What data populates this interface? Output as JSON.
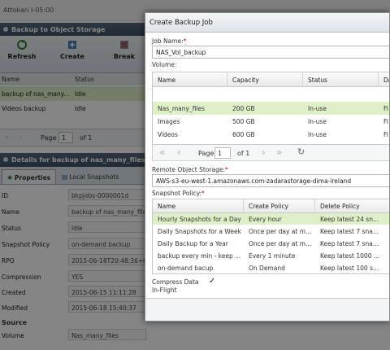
{
  "app": {
    "header_text": "Attokari I-05:00"
  },
  "bg": {
    "panel_title": "Backup to Object Storage",
    "toolbar": {
      "refresh": "Refresh",
      "create": "Create",
      "break": "Break"
    },
    "columns": [
      "Name",
      "Status"
    ],
    "rows": [
      [
        "backup of nas_many...",
        "Idle"
      ],
      [
        "Videos backup",
        "Idle"
      ]
    ],
    "pager": {
      "page_label": "Page",
      "page_value": "1",
      "of_label": "of 1"
    },
    "details_title": "Details for backup of nas_many_files",
    "tabs": [
      "Properties",
      "Local Snapshots"
    ],
    "details": [
      {
        "k": "ID",
        "v": "bkpjobs-0000001d"
      },
      {
        "k": "Name",
        "v": "backup of nas_many_files"
      },
      {
        "k": "Status",
        "v": "Idle"
      },
      {
        "k": "Snapshot Policy",
        "v": "on-demand backup"
      },
      {
        "k": "RPO",
        "v": "2015-06-18T20:48:36+00"
      },
      {
        "k": "Compression",
        "v": "YES"
      },
      {
        "k": "Created",
        "v": "2015-06-15 11:11:28"
      },
      {
        "k": "Modified",
        "v": "2015-06-18 15:40:37"
      }
    ],
    "source_label": "Source",
    "volume": {
      "k": "Volume",
      "v": "Nas_many_files"
    }
  },
  "dialog": {
    "title": "Create Backup Job",
    "job_name_label": "Job Name:",
    "required_mark": "*",
    "job_name_value": "NAS_Vol_backup",
    "volume_label": "Volume:",
    "volume_columns": [
      "Name",
      "Capacity",
      "Status",
      "Da"
    ],
    "volumes": [
      [
        "Nas_many_files",
        "200 GB",
        "In-use",
        "Fi"
      ],
      [
        "Images",
        "500 GB",
        "In-use",
        "Fi"
      ],
      [
        "Videos",
        "600 GB",
        "In-use",
        "Fi"
      ]
    ],
    "pager": {
      "page_label": "Page",
      "page_value": "1",
      "of_label": "of 1"
    },
    "remote_label": "Remote Object Storage:",
    "remote_value": "AWS-s3-eu-west-1.amazonaws.com-zadarastorage-dima-ireland",
    "policy_label": "Snapshot Policy:",
    "policy_columns": [
      "Name",
      "Create Policy",
      "Delete Policy"
    ],
    "policies": [
      [
        "Hourly Snapshots for a Day",
        "Every hour",
        "Keep latest 24 sn..."
      ],
      [
        "Daily Snapshots for a Week",
        "Once per day at m...",
        "Keep latest 7 sna..."
      ],
      [
        "Daily Backup for a Year",
        "Once per day at m...",
        "Keep latest 7 sna..."
      ],
      [
        "backup every min - keep ...",
        "Every 1 minute",
        "Keep latest 1000 ..."
      ],
      [
        "on-demand bacup",
        "On Demand",
        "Keep latest 100 s..."
      ]
    ],
    "compress_label": "Compress Data In-Flight",
    "compress_checked": "✓"
  },
  "colors": {
    "accent_header": "#3c5164",
    "selected_row": "#dff0c8",
    "refresh_icon": "#2e7d32",
    "create_icon": "#4a7ebf"
  }
}
